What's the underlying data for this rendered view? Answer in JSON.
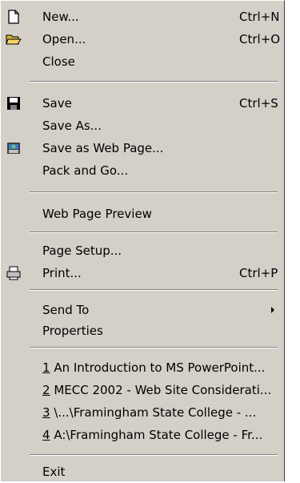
{
  "menu": {
    "new": {
      "label": "New...",
      "shortcut": "Ctrl+N",
      "icon": "new-document-icon"
    },
    "open": {
      "label": "Open...",
      "shortcut": "Ctrl+O",
      "icon": "open-folder-icon"
    },
    "close": {
      "label": "Close"
    },
    "save": {
      "label": "Save",
      "shortcut": "Ctrl+S",
      "icon": "floppy-disk-icon"
    },
    "save_as": {
      "label": "Save As..."
    },
    "save_web": {
      "label": "Save as Web Page...",
      "icon": "web-page-icon"
    },
    "pack_go": {
      "label": "Pack and Go..."
    },
    "web_preview": {
      "label": "Web Page Preview"
    },
    "page_setup": {
      "label": "Page Setup..."
    },
    "print": {
      "label": "Print...",
      "shortcut": "Ctrl+P",
      "icon": "printer-icon"
    },
    "send_to": {
      "label": "Send To"
    },
    "properties": {
      "label": "Properties"
    },
    "recent": [
      {
        "num": "1",
        "label": "An Introduction to MS PowerPoint..."
      },
      {
        "num": "2",
        "label": "MECC 2002 - Web Site Considerati..."
      },
      {
        "num": "3",
        "label": "\\...\\Framingham State College - ..."
      },
      {
        "num": "4",
        "label": "A:\\Framingham State College - Fr..."
      }
    ],
    "exit": {
      "label": "Exit"
    }
  }
}
